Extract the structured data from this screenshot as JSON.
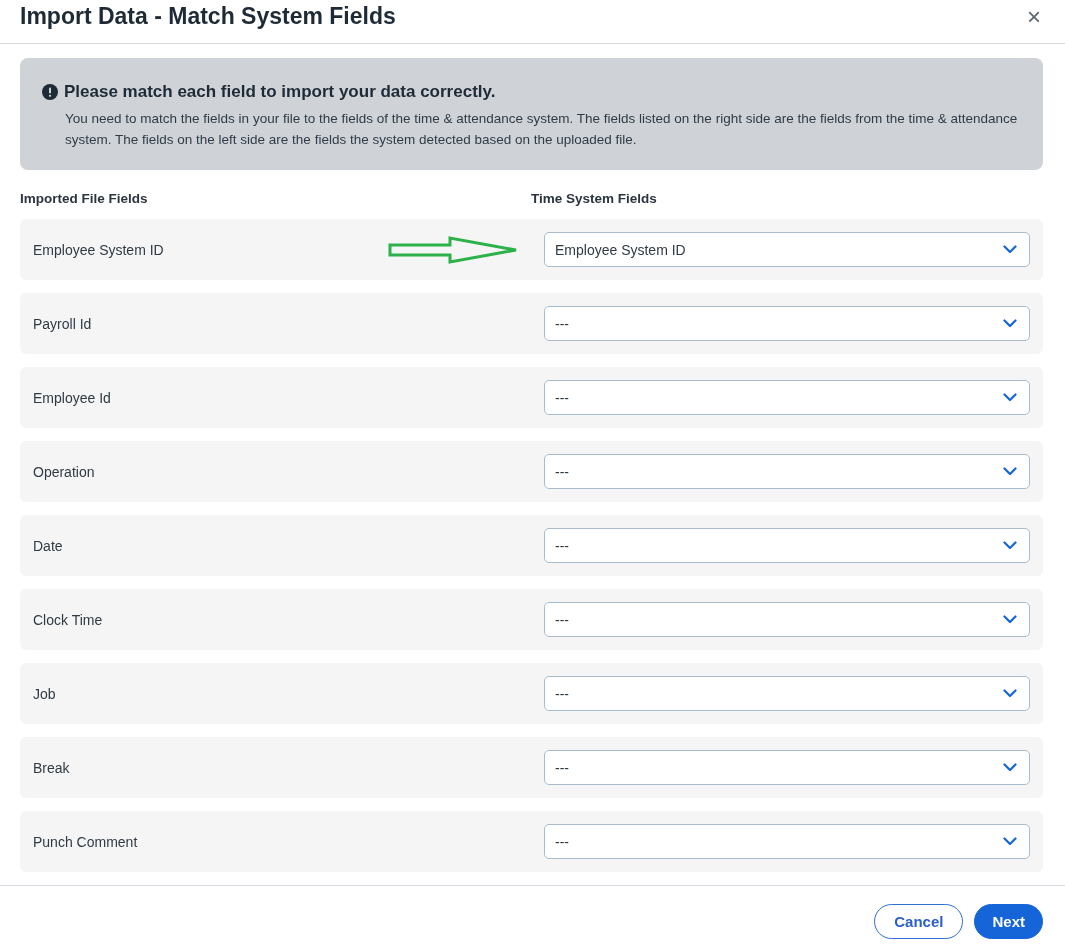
{
  "dialog": {
    "title": "Import Data - Match System Fields",
    "close_label": "×"
  },
  "notice": {
    "heading": "Please match each field to import your data correctly.",
    "body": "You need to match the fields in your file to the fields of the time & attendance system. The fields listed on the right side are the fields from the time & attendance system. The fields on the left side are the fields the system detected based on the uploaded file."
  },
  "columns": [
    "Imported File Fields",
    "Time System Fields"
  ],
  "rows": [
    {
      "field": "Employee System ID",
      "value": "Employee System ID",
      "arrow": true
    },
    {
      "field": "Payroll Id",
      "value": "---",
      "arrow": false
    },
    {
      "field": "Employee Id",
      "value": "---",
      "arrow": false
    },
    {
      "field": "Operation",
      "value": "---",
      "arrow": false
    },
    {
      "field": "Date",
      "value": "---",
      "arrow": false
    },
    {
      "field": "Clock Time",
      "value": "---",
      "arrow": false
    },
    {
      "field": "Job",
      "value": "---",
      "arrow": false
    },
    {
      "field": "Break",
      "value": "---",
      "arrow": false
    },
    {
      "field": "Punch Comment",
      "value": "---",
      "arrow": false
    }
  ],
  "buttons": [
    {
      "label": "Cancel",
      "kind": "secondary"
    },
    {
      "label": "Next",
      "kind": "primary"
    }
  ]
}
